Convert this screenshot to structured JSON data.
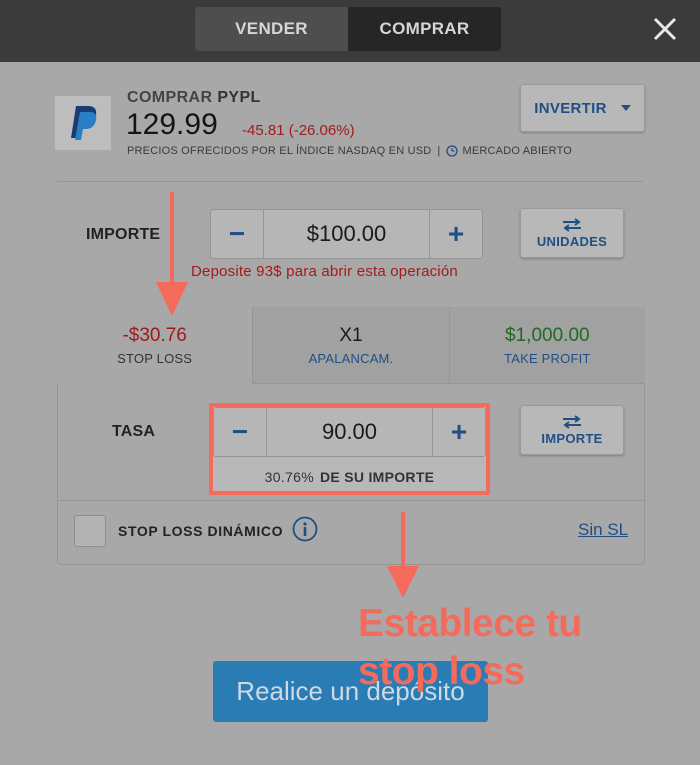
{
  "header": {
    "sell_label": "VENDER",
    "buy_label": "COMPRAR",
    "close_icon": "close-icon"
  },
  "instrument": {
    "action": "COMPRAR",
    "symbol": "PYPL",
    "price": "129.99",
    "change": "-45.81 (-26.06%)",
    "source_note": "PRECIOS OFRECIDOS POR EL ÍNDICE NASDAQ EN USD",
    "separator": "|",
    "market_status": "MERCADO ABIERTO",
    "logo_icon": "paypal-logo"
  },
  "invert_button": {
    "label": "INVERTIR"
  },
  "amount": {
    "label": "IMPORTE",
    "value": "$100.00",
    "minus": "−",
    "plus": "+",
    "units_button": "UNIDADES",
    "warning": "Deposite 93$ para abrir esta operación"
  },
  "tabs": [
    {
      "value": "-$30.76",
      "label": "STOP LOSS"
    },
    {
      "value": "X1",
      "label": "APALANCAM."
    },
    {
      "value": "$1,000.00",
      "label": "TAKE PROFIT"
    }
  ],
  "rate": {
    "label": "TASA",
    "value": "90.00",
    "minus": "−",
    "plus": "+",
    "percent": "30.76%",
    "percent_suffix": "DE SU IMPORTE",
    "amount_button": "IMPORTE"
  },
  "dynamic_sl": {
    "label": "STOP LOSS DINÁMICO",
    "info_icon": "info-icon",
    "link": "Sin SL",
    "checked": false
  },
  "deposit_button": {
    "label": "Realice un depósito"
  },
  "annotation": {
    "line1": "Establece tu",
    "line2": "stop loss"
  },
  "colors": {
    "accent_blue": "#1f4f85",
    "loss_red": "#9e1a1a",
    "profit_green": "#1f6b1f",
    "highlight": "#f46b5c",
    "deposit_blue": "#2a7cb4"
  }
}
